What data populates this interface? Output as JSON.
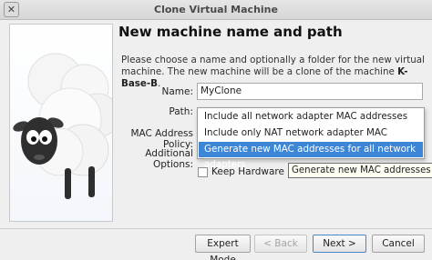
{
  "window": {
    "title": "Clone Virtual Machine",
    "close_glyph": "✕"
  },
  "page": {
    "heading": "New machine name and path",
    "description_start": "Please choose a name and optionally a folder for the new virtual machine. The new machine will be a clone of the machine ",
    "machine_name": "K-Base-B",
    "description_end": "."
  },
  "form": {
    "name_label": "Name:",
    "name_value": "MyClone",
    "path_label": "Path:",
    "mac_label": "MAC Address Policy:",
    "additional_label": "Additional Options:",
    "keep_hw_label": "Keep Hardware UUIDs",
    "keep_hw_checked": false
  },
  "mac_policy_options": [
    "Include all network adapter MAC addresses",
    "Include only NAT network adapter MAC addresses",
    "Generate new MAC addresses for all network adapters"
  ],
  "selected_option_index": 2,
  "tooltip": "Generate new MAC addresses for all n",
  "buttons": {
    "expert": "Expert Mode",
    "back": "< Back",
    "next": "Next >",
    "cancel": "Cancel"
  },
  "colors": {
    "selection": "#3d86d6",
    "tooltip_bg": "#fdfdf2"
  },
  "icons": {
    "close": "close-icon",
    "sidebar": "sheep-illustration"
  }
}
